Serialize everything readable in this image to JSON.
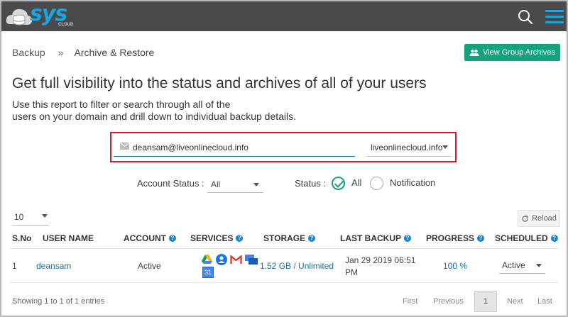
{
  "header": {
    "logo_text": "sys",
    "logo_sub": "CLOUD",
    "search_icon": "search-icon",
    "menu_icon": "menu-icon"
  },
  "breadcrumb": {
    "items": [
      "Backup",
      "Archive & Restore"
    ],
    "separator": "»"
  },
  "actions": {
    "view_group_archives": "View Group Archives"
  },
  "page": {
    "headline": "Get full visibility into the status and archives of all of your users",
    "description_line1": "Use this report to filter or search through all of the",
    "description_line2": "users on your domain and drill down to individual backup details."
  },
  "search": {
    "email_value": "deansam@liveonlinecloud.info",
    "domain_value": "liveonlinecloud.info"
  },
  "filters": {
    "account_status_label": "Account Status :",
    "account_status_value": "All",
    "status_label": "Status :",
    "status_options": [
      "All",
      "Notification"
    ],
    "status_selected": "All"
  },
  "table_controls": {
    "page_size": "10",
    "reload_label": "Reload"
  },
  "table": {
    "columns": [
      "S.No",
      "USER NAME",
      "ACCOUNT",
      "SERVICES",
      "STORAGE",
      "LAST BACKUP",
      "PROGRESS",
      "SCHEDULED"
    ],
    "rows": [
      {
        "sno": "1",
        "user_name": "deansam",
        "account": "Active",
        "services": [
          "google-drive-icon",
          "google-contacts-icon",
          "gmail-icon",
          "google-sites-icon",
          "google-calendar-icon"
        ],
        "calendar_day": "31",
        "storage": "1.52 GB / Unlimited",
        "last_backup_line1": "Jan 29 2019 06:51",
        "last_backup_line2": "PM",
        "progress": "100 %",
        "scheduled": "Active"
      }
    ]
  },
  "pagination": {
    "summary": "Showing 1 to 1 of 1 entries",
    "first": "First",
    "previous": "Previous",
    "current": "1",
    "next": "Next",
    "last": "Last"
  },
  "colors": {
    "accent_green": "#14a37f",
    "brand_blue": "#1ea5de",
    "highlight_red": "#c8222a",
    "header_bg": "#4a4a4a"
  }
}
